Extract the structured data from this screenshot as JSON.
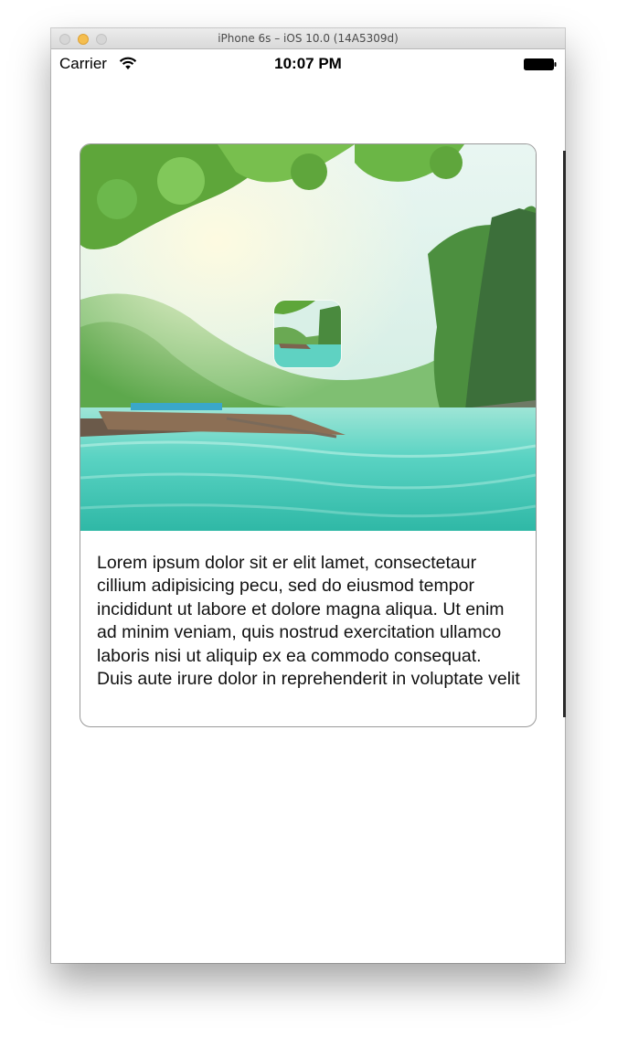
{
  "window": {
    "title": "iPhone 6s – iOS 10.0 (14A5309d)"
  },
  "status_bar": {
    "carrier": "Carrier",
    "time": "10:07 PM",
    "icons": [
      "wifi-icon",
      "battery-icon"
    ]
  },
  "card": {
    "hero_image": "tropical-lagoon-with-boats",
    "thumbnail_image": "tropical-lagoon-thumbnail",
    "description": "Lorem ipsum dolor sit er elit lamet, consectetaur cillium adipisicing pecu, sed do eiusmod tempor incididunt ut labore et dolore magna aliqua. Ut enim ad minim veniam, quis nostrud exercitation ullamco laboris nisi ut aliquip ex ea commodo consequat. Duis aute irure dolor in reprehenderit in voluptate velit"
  },
  "colors": {
    "minimize_button": "#f5be4f",
    "water": "#4fd3c4",
    "foliage": "#5fae3c",
    "card_border": "#9a9a9a"
  }
}
